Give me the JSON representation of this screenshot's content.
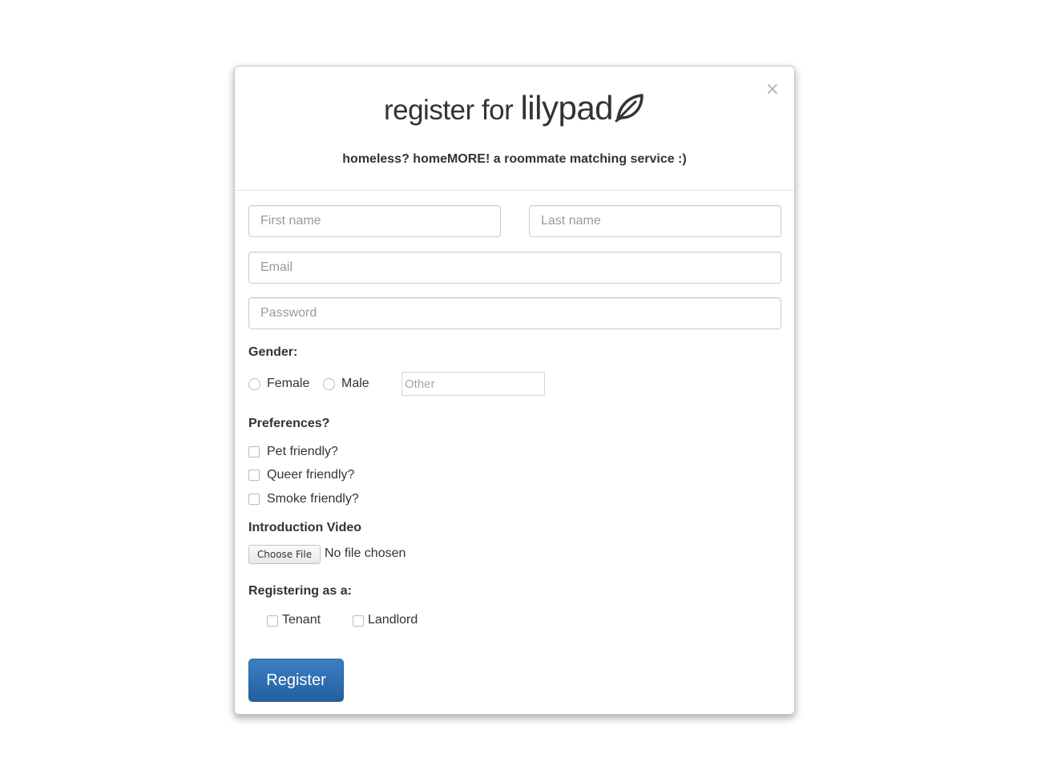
{
  "modal": {
    "close_glyph": "×",
    "title_prefix": "register for",
    "brand_name": "lilypad",
    "subtitle": "homeless? homeMORE! a roommate matching service :)"
  },
  "form": {
    "first_name": {
      "placeholder": "First name",
      "value": ""
    },
    "last_name": {
      "placeholder": "Last name",
      "value": ""
    },
    "email": {
      "placeholder": "Email",
      "value": ""
    },
    "password": {
      "placeholder": "Password",
      "value": ""
    },
    "gender": {
      "label": "Gender:",
      "options": [
        "Female",
        "Male"
      ],
      "other_placeholder": "Other"
    },
    "preferences": {
      "label": "Preferences?",
      "options": [
        "Pet friendly?",
        "Queer friendly?",
        "Smoke friendly?"
      ]
    },
    "video": {
      "label": "Introduction Video",
      "button_label": "Choose File",
      "status": "No file chosen"
    },
    "registering_as": {
      "label": "Registering as a:",
      "options": [
        "Tenant",
        "Landlord"
      ]
    },
    "submit_label": "Register"
  },
  "colors": {
    "primary_button": "#2a6aad",
    "border": "#cccccc",
    "placeholder": "#999999"
  },
  "icons": {
    "brand": "leaf-icon",
    "close": "close-icon"
  }
}
